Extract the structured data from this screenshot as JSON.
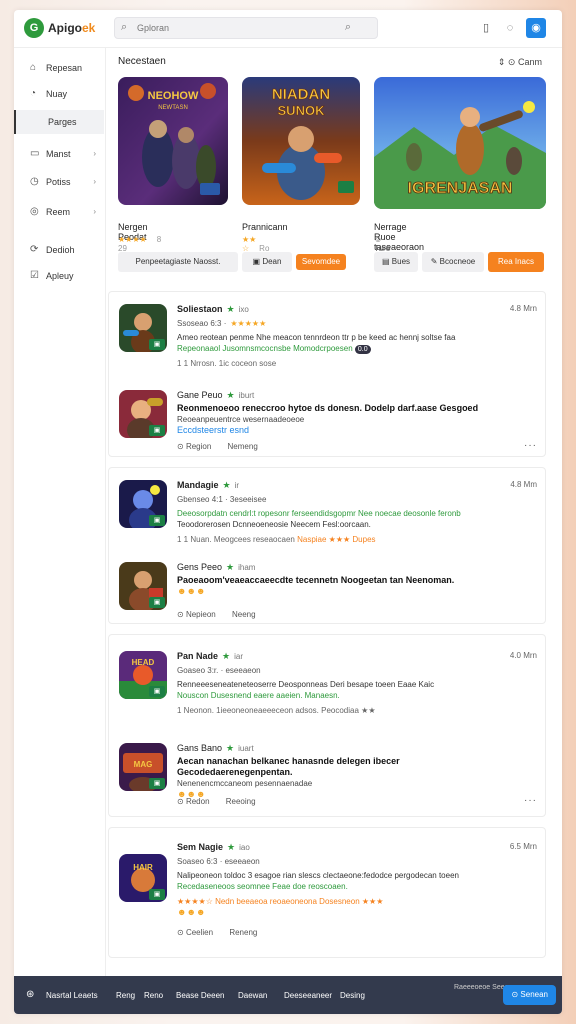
{
  "header": {
    "logo_mark": "G",
    "logo_text": "Apigo",
    "logo_accent": "ek",
    "search_placeholder": "Gploran",
    "icons": [
      "search-icon",
      "calendar-icon",
      "bell-icon",
      "user-icon"
    ]
  },
  "sidebar": {
    "items": [
      {
        "label": "Repesan",
        "icon": "⌂"
      },
      {
        "label": "Nuay",
        "icon": "◔"
      },
      {
        "label": "Parges",
        "icon": "▮"
      },
      {
        "label": "Manst",
        "icon": "▭"
      },
      {
        "label": "Potiss",
        "icon": "◷"
      },
      {
        "label": "Reem",
        "icon": "◎"
      },
      {
        "label": "Dedioh",
        "icon": "⟳"
      },
      {
        "label": "Apleuy",
        "icon": "☑"
      }
    ]
  },
  "featured": {
    "title": "Necestaen",
    "sort_label": "Canm",
    "games": [
      {
        "art_title": "NEOHOW",
        "art_sub": "NEWTASN",
        "title": "Nergen Peodat",
        "stars": "★★★★",
        "count": "8 29",
        "btn1": "Penpeetagiaste Naosst.",
        "btn2": ""
      },
      {
        "art_title": "NIADAN",
        "art_sub": "SUNOK",
        "title": "Prannicann",
        "stars": "★★ ☆",
        "count": "Ro 9e",
        "btn1": "Dean",
        "btn2": "Sevomdee"
      },
      {
        "art_title": "IGRENJASAN",
        "art_sub": "",
        "title": "Nerrage Ruoe taseaeoraon",
        "stars": "☺",
        "count": "Ture aeor 5 9e",
        "btn1": "Bues",
        "btn2": "Bcocneoe",
        "btn3": "Rea Inacs"
      }
    ]
  },
  "cards": [
    {
      "name": "Soliestaon",
      "hr": "ixo",
      "time": "4.8 Mrn",
      "meta": "Ssoseao 6:3 ·",
      "meta_stars": "★★★★★",
      "body1": "Ameo reotean penme Nhe meacon tennrdeon ttr p be keed ac hennj soltse faa",
      "body2": "Repeonaaol Jusomnsmcocnsbe Momodcrpoesen",
      "pill": "0.0",
      "body3": "1 1 Nrrosn. 1ic coceon sose",
      "c_name": "Gane Peuo",
      "c_hr": "iburt",
      "c_body": "Reonmenoeoo reneccroo hytoe ds donesn. Dodelp darf.aase Gesgoed",
      "c_sub": "Reoeanpeuentrce wesernaadeoeoe",
      "c_blue": "Eccdsteerstr esnd",
      "act1": "Region",
      "act2": "Nemeng"
    },
    {
      "name": "Mandagie",
      "hr": "ir",
      "time": "4.8 Mm",
      "meta": "Gbenseo 4:1 · 3eseeisee",
      "meta_stars": "",
      "body1": "Deeosorpdatn cendrl:t ropesonr ferseendidsgopmr Nee noecae deosonle feronb",
      "body2": "Teoodorerosen Dcnneoeneosie Neecem Fesl:oorcaan.",
      "pill": "",
      "body3": "1 1 Nuan. Meogcees reseaocaen",
      "extra": "Naspiae ★★★ Dupes",
      "c_name": "Gens Peeo",
      "c_hr": "iham",
      "c_body": "Paoeaoom'veaeaccaeecdte tecennetn Noogeetan tan Neenoman.",
      "c_sub": "",
      "c_blue": "",
      "act1": "Nepieon",
      "act2": "Neeng"
    },
    {
      "name": "Pan Nade",
      "hr": "iar",
      "time": "4.0 Mrn",
      "meta": "Goaseo 3:r. · eseeaeon",
      "meta_stars": "",
      "body1": "Renneeeseneateneteoserre Deosponneas Deri besape toeen Eaae Kaic",
      "body2": "Nouscon Dusesnend eaere aaeien. Manaesn.",
      "pill": "",
      "body3": "1 Neonon. 1ieeoneoneaeeeceon adsos. Peocodiaa ★★",
      "c_name": "Gans Bano",
      "c_hr": "iuart",
      "c_body": "Aecan nanachan belkanec hanasnde delegen ibecer Gecodedaerenegenpentan.",
      "c_sub": "Nenenencmccaneom pesennaenadae",
      "c_blue": "",
      "act1": "Redon",
      "act2": "Reeoing"
    },
    {
      "name": "Sem Nagie",
      "hr": "iao",
      "time": "6.5 Mrn",
      "meta": "Soaseo 6:3 · eseeaeon",
      "meta_stars": "",
      "body1": "Nalipeoneon toldoc 3 esagoe rian slescs clectaeone:fedodce pergodecan toeen",
      "body2": "Recedaseneoos seomnee Feae doe reoscoaen.",
      "pill": "",
      "body3": "★★★★☆  Nedn beeaeoa reoaeoneona Dosesneon ★★★",
      "c_name": "",
      "c_hr": "",
      "c_body": "",
      "c_sub": "",
      "c_blue": "",
      "act1": "Ceelien",
      "act2": "Reneng"
    }
  ],
  "footer": {
    "brand": "Nasrtal Leaets",
    "items": [
      "Reng",
      "Reno",
      "Bease Deeen",
      "Daewan",
      "Deeseeaneer",
      "Desing"
    ],
    "right_text": "Raeeeoeoe Seeaon",
    "button": "Senean"
  }
}
